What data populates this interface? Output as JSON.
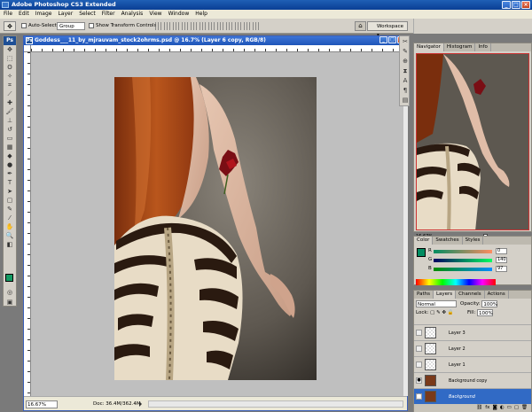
{
  "app": {
    "title": "Adobe Photoshop CS3 Extended"
  },
  "menu": [
    "File",
    "Edit",
    "Image",
    "Layer",
    "Select",
    "Filter",
    "Analysis",
    "View",
    "Window",
    "Help"
  ],
  "options": {
    "auto_select_label": "Auto-Select:",
    "auto_select_value": "Group",
    "transform_label": "Show Transform Controls",
    "workspace_label": "Workspace"
  },
  "document": {
    "title": "Goddess___11_by_mjrauvam_stock2ohrms.psd @ 16.7% (Layer 6 copy, RGB/8)",
    "zoom": "16.67%",
    "doc_info": "Doc: 36.4M/362.4M"
  },
  "navigator": {
    "tabs": [
      "Navigator",
      "Histogram",
      "Info"
    ],
    "zoom": "16.67%"
  },
  "color": {
    "tabs": [
      "Color",
      "Swatches",
      "Styles"
    ],
    "r": "0",
    "g": "140",
    "b": "97",
    "labels": [
      "R",
      "G",
      "B"
    ],
    "fg_color": "#008c61"
  },
  "layers": {
    "tabs": [
      "Paths",
      "Layers",
      "Channels",
      "Actions"
    ],
    "blend": "Normal",
    "opacity_label": "Opacity:",
    "opacity": "100%",
    "lock_label": "Lock:",
    "fill_label": "Fill:",
    "fill": "100%",
    "items": [
      "Layer 3",
      "Layer 2",
      "Layer 1",
      "Background copy",
      "Background"
    ]
  }
}
